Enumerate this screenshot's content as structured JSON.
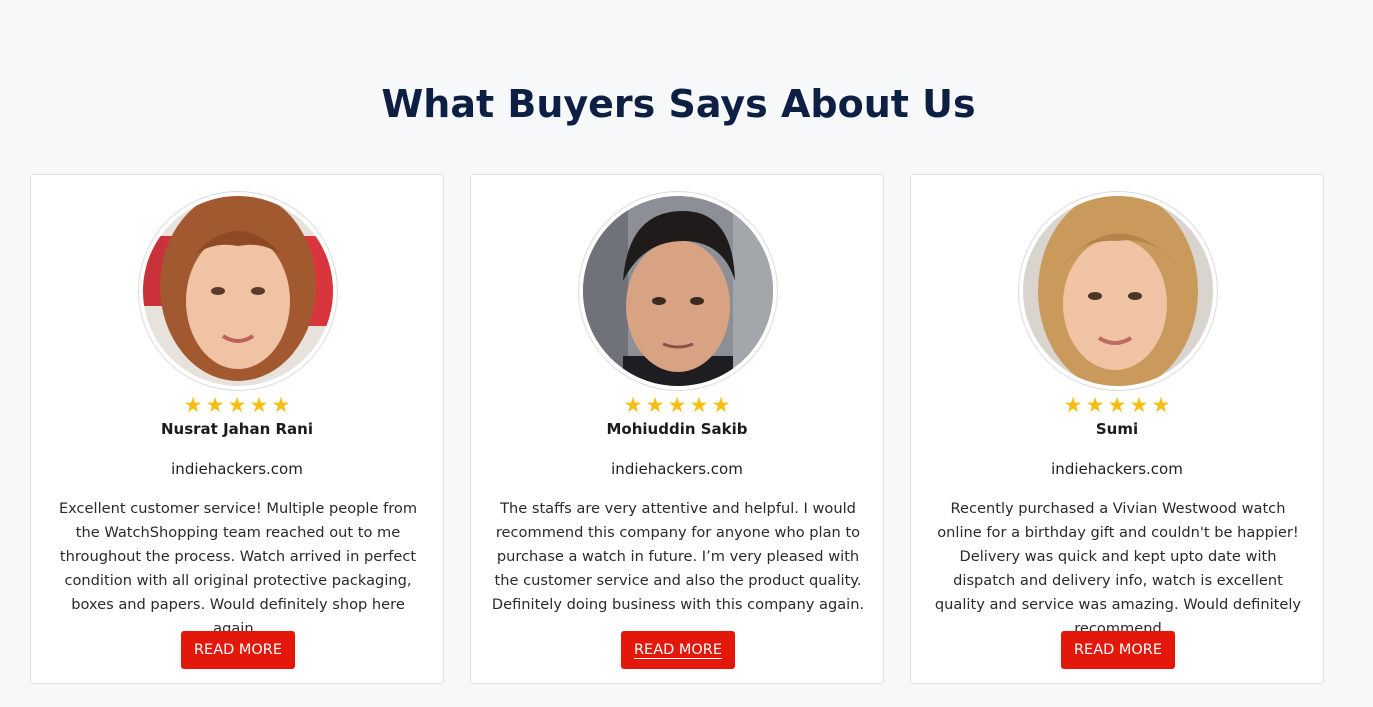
{
  "section": {
    "title": "What Buyers Says About Us"
  },
  "testimonials": [
    {
      "name": "Nusrat Jahan Rani",
      "site": "indiehackers.com",
      "rating": 5,
      "review": "Excellent customer service! Multiple people from the WatchShopping team reached out to me throughout the process. Watch arrived in perfect condition with all original protective packaging, boxes and papers. Would definitely shop here again..",
      "button": "READ MORE"
    },
    {
      "name": "Mohiuddin Sakib",
      "site": "indiehackers.com",
      "rating": 5,
      "review": "The staffs are very attentive and helpful. I would recommend this company for anyone who plan to purchase a watch in future. I’m very pleased with the customer service and also the product quality. Definitely doing business with this company again.",
      "button": "READ MORE"
    },
    {
      "name": "Sumi",
      "site": "indiehackers.com",
      "rating": 5,
      "review": "Recently purchased a Vivian Westwood watch online for a birthday gift and couldn't be happier! Delivery was quick and kept upto date with dispatch and delivery info, watch is excellent quality and service was amazing. Would definitely recommend",
      "button": "READ MORE"
    }
  ],
  "colors": {
    "heading": "#0d1f42",
    "star": "#f6be12",
    "button": "#e3180a",
    "background": "#f7f8fa"
  },
  "icons": {
    "star": "star-icon",
    "avatar": "avatar"
  }
}
